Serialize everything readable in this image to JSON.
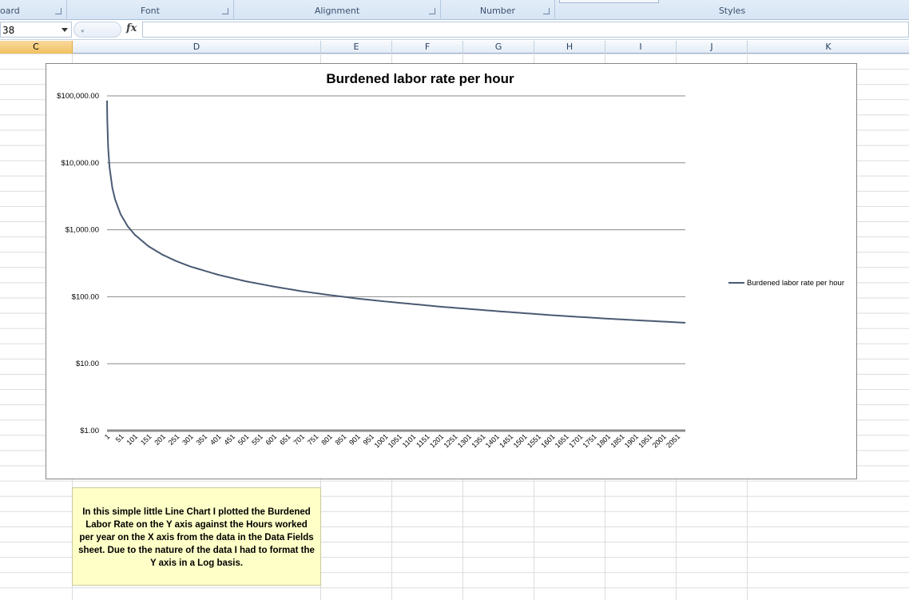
{
  "ribbon": {
    "groups": [
      {
        "label": "oard"
      },
      {
        "label": "Font"
      },
      {
        "label": "Alignment"
      },
      {
        "label": "Number"
      },
      {
        "label": "Styles"
      }
    ]
  },
  "formula_bar": {
    "name_box": "38",
    "fx_label": "fx",
    "formula": ""
  },
  "columns": [
    "C",
    "D",
    "E",
    "F",
    "G",
    "H",
    "I",
    "J",
    "K"
  ],
  "selected_column": "C",
  "chart_data": {
    "type": "line",
    "title": "Burdened labor rate per hour",
    "xlabel": "",
    "ylabel": "",
    "x_tick_labels": [
      "1",
      "51",
      "101",
      "151",
      "201",
      "251",
      "301",
      "351",
      "401",
      "451",
      "501",
      "551",
      "601",
      "651",
      "701",
      "751",
      "801",
      "851",
      "901",
      "951",
      "1001",
      "1051",
      "1101",
      "1151",
      "1201",
      "1251",
      "1301",
      "1351",
      "1401",
      "1451",
      "1501",
      "1551",
      "1601",
      "1651",
      "1701",
      "1751",
      "1801",
      "1851",
      "1901",
      "1951",
      "2001",
      "2051"
    ],
    "y_tick_labels": [
      "$100,000.00",
      "$10,000.00",
      "$1,000.00",
      "$100.00",
      "$10.00",
      "$1.00"
    ],
    "y_scale": "log",
    "ylim": [
      1,
      100000
    ],
    "xlim": [
      1,
      2080
    ],
    "grid": true,
    "legend_position": "right",
    "series": [
      {
        "name": "Burdened labor rate per hour",
        "color": "#4a5a73",
        "x": [
          1,
          2,
          5,
          10,
          20,
          30,
          50,
          75,
          101,
          150,
          200,
          250,
          300,
          400,
          500,
          600,
          700,
          800,
          850,
          900,
          1000,
          1200,
          1400,
          1600,
          1800,
          2000,
          2080
        ],
        "y": [
          85000,
          42500,
          17000,
          8500,
          4250,
          2833,
          1700,
          1133,
          842,
          567,
          425,
          340,
          283,
          213,
          170,
          142,
          121,
          106,
          100,
          94,
          85,
          71,
          61,
          53,
          47,
          42.5,
          40.9
        ]
      }
    ]
  },
  "note": {
    "text": "In this simple little Line Chart I plotted the Burdened Labor Rate on the Y axis against the Hours worked per year on the X axis from the data in the Data Fields sheet. Due to the nature of the data I had to format the Y axis in a Log basis."
  }
}
